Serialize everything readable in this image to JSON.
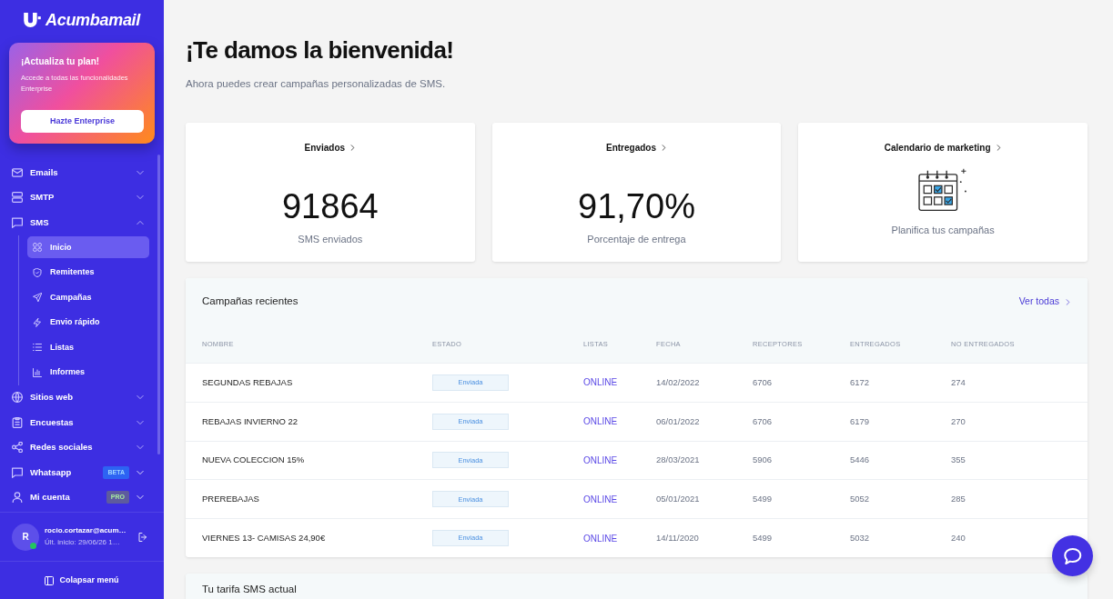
{
  "sidebar": {
    "brand": "Acumbamail",
    "promo": {
      "title": "¡Actualiza tu plan!",
      "text": "Accede a todas las funcionalidades Enterprise",
      "button": "Hazte Enterprise"
    },
    "items": [
      {
        "label": "Emails",
        "selected": false,
        "expanded": false
      },
      {
        "label": "SMTP",
        "selected": false,
        "expanded": false
      },
      {
        "label": "SMS",
        "selected": false,
        "expanded": true,
        "children": [
          {
            "label": "Inicio",
            "selected": true
          },
          {
            "label": "Remitentes",
            "selected": false
          },
          {
            "label": "Campañas",
            "selected": false
          },
          {
            "label": "Envio rápido",
            "selected": false
          },
          {
            "label": "Listas",
            "selected": false
          },
          {
            "label": "Informes",
            "selected": false
          }
        ]
      },
      {
        "label": "Sitios web",
        "selected": false,
        "expanded": false
      },
      {
        "label": "Encuestas",
        "selected": false,
        "expanded": false
      },
      {
        "label": "Redes sociales",
        "selected": false,
        "expanded": false
      },
      {
        "label": "Whatsapp",
        "selected": false,
        "expanded": false,
        "badge": {
          "text": "BETA",
          "kind": "beta"
        }
      },
      {
        "label": "Mi cuenta",
        "selected": false,
        "expanded": false,
        "badge": {
          "text": "PRO",
          "kind": "pro"
        }
      }
    ],
    "user": {
      "initial": "R",
      "online": true,
      "email": "rocio.cortazar@acum…",
      "last_login": "Últ. inicio: 29/06/26 1…"
    },
    "collapse_label": "Colapsar menú"
  },
  "main": {
    "title": "¡Te damos la bienvenida!",
    "subtitle": "Ahora puedes crear campañas personalizadas de SMS.",
    "cards": [
      {
        "kind": "stat",
        "title": "Enviados",
        "value": "91864",
        "caption": "SMS enviados"
      },
      {
        "kind": "stat",
        "title": "Entregados",
        "value": "91,70%",
        "caption": "Porcentaje de entrega"
      },
      {
        "kind": "illustration",
        "title": "Calendario de marketing",
        "caption": "Planifica tus campañas"
      }
    ],
    "recent_campaigns": {
      "title": "Campañas recientes",
      "link": "Ver todas",
      "columns": [
        {
          "label": "NOMBRE",
          "kind": "name"
        },
        {
          "label": "ESTADO",
          "kind": "badge"
        },
        {
          "label": "LISTAS",
          "kind": "link"
        },
        {
          "label": "FECHA",
          "kind": "text"
        },
        {
          "label": "RECEPTORES",
          "kind": "text"
        },
        {
          "label": "ENTREGADOS",
          "kind": "text"
        },
        {
          "label": "NO ENTREGADOS",
          "kind": "text"
        }
      ],
      "rows": [
        [
          "SEGUNDAS REBAJAS",
          "Enviada",
          "ONLINE",
          "14/02/2022",
          "6706",
          "6172",
          "274"
        ],
        [
          "REBAJAS INVIERNO 22",
          "Enviada",
          "ONLINE",
          "06/01/2022",
          "6706",
          "6179",
          "270"
        ],
        [
          "NUEVA COLECCION 15%",
          "Enviada",
          "ONLINE",
          "28/03/2021",
          "5906",
          "5446",
          "355"
        ],
        [
          "PREREBAJAS",
          "Enviada",
          "ONLINE",
          "05/01/2021",
          "5499",
          "5052",
          "285"
        ],
        [
          "VIERNES 13- CAMISAS 24,90€",
          "Enviada",
          "ONLINE",
          "14/11/2020",
          "5499",
          "5032",
          "240"
        ]
      ]
    },
    "tariff": {
      "title": "Tu tarifa SMS actual"
    }
  }
}
